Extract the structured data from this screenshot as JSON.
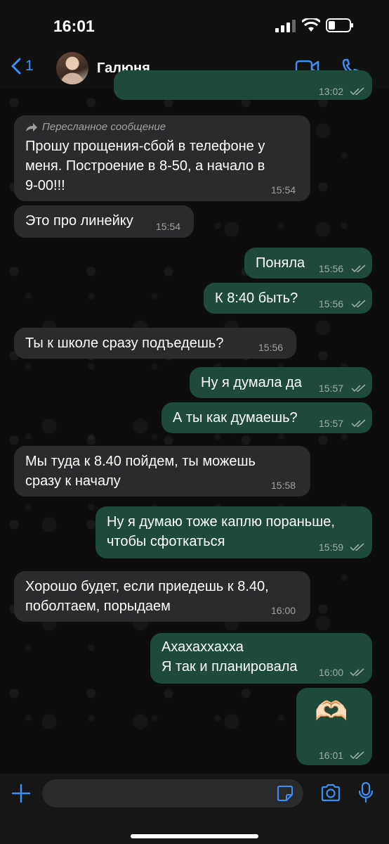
{
  "status": {
    "time": "16:01"
  },
  "header": {
    "back_count": "1",
    "contact_name": "Галюня"
  },
  "messages": [
    {
      "time": "13:02"
    },
    {
      "forward_label": "Пересланное сообщение",
      "text": "Прошу прощения-сбой в телефоне у\nменя. Построение в 8-50, а начало в\n9-00!!!",
      "time": "15:54"
    },
    {
      "text": "Это про линейку",
      "time": "15:54"
    },
    {
      "text": "Поняла",
      "time": "15:56"
    },
    {
      "text": "К 8:40 быть?",
      "time": "15:56"
    },
    {
      "text": "Ты к школе сразу подъедешь?",
      "time": "15:56"
    },
    {
      "text": "Ну я думала да",
      "time": "15:57"
    },
    {
      "text": "А ты как думаешь?",
      "time": "15:57"
    },
    {
      "text": "Мы туда к 8.40 пойдем, ты можешь\nсразу к началу",
      "time": "15:58"
    },
    {
      "text": "Ну я думаю тоже каплю пораньше,\nчтобы сфоткаться",
      "time": "15:59"
    },
    {
      "text": "Хорошо будет, если приедешь к 8.40,\nпоболтаем, порыдаем",
      "time": "16:00"
    },
    {
      "text": "Ахахаххахха\nЯ так и планировала",
      "time": "16:00"
    },
    {
      "text": "🫶🏻",
      "time": "16:01"
    }
  ],
  "colors": {
    "accent": "#3b8ff5",
    "outgoing": "#1e4a3c",
    "incoming": "#2b2b2d"
  },
  "icons": [
    "chevron-left-icon",
    "video-icon",
    "phone-icon",
    "plus-icon",
    "sticker-icon",
    "camera-icon",
    "mic-icon",
    "forward-icon",
    "double-check-icon"
  ]
}
